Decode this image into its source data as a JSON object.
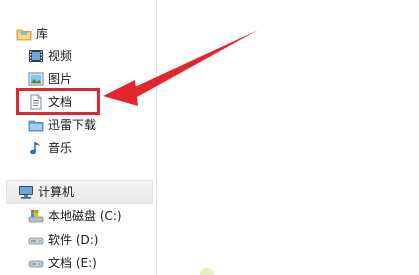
{
  "nav": {
    "library": {
      "label": "库",
      "icon": "library-folder-icon"
    },
    "library_items": [
      {
        "label": "视频",
        "icon": "video-icon"
      },
      {
        "label": "图片",
        "icon": "picture-icon"
      },
      {
        "label": "文档",
        "icon": "document-icon"
      },
      {
        "label": "迅雷下载",
        "icon": "download-folder-icon"
      },
      {
        "label": "音乐",
        "icon": "music-icon"
      }
    ],
    "computer": {
      "label": "计算机",
      "icon": "computer-icon"
    },
    "drives": [
      {
        "label": "本地磁盘 (C:)",
        "icon": "system-drive-icon"
      },
      {
        "label": "软件 (D:)",
        "icon": "drive-icon"
      },
      {
        "label": "文档 (E:)",
        "icon": "drive-icon"
      }
    ]
  },
  "annotation": {
    "color": "#e3262e",
    "target": "文档"
  }
}
